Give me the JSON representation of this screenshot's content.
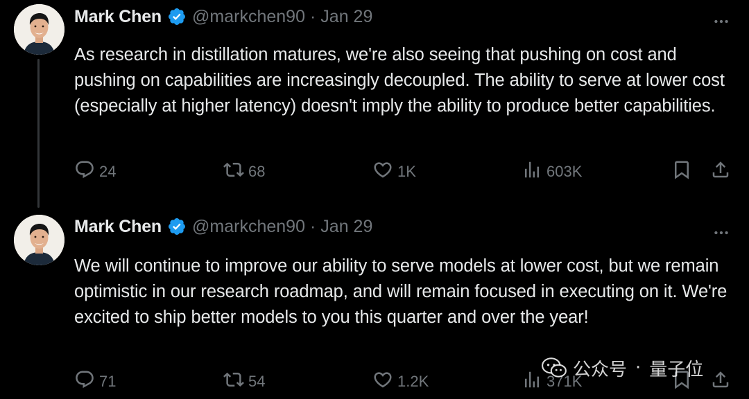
{
  "tweets": [
    {
      "author": "Mark Chen",
      "handle": "@markchen90",
      "separator": "·",
      "date": "Jan 29",
      "text": "As research in distillation matures, we're also seeing that pushing on cost and pushing on capabilities are increasingly decoupled. The ability to serve at lower cost (especially at higher latency) doesn't imply the ability to produce better capabilities.",
      "replies": "24",
      "reposts": "68",
      "likes": "1K",
      "views": "603K"
    },
    {
      "author": "Mark Chen",
      "handle": "@markchen90",
      "separator": "·",
      "date": "Jan 29",
      "text": "We will continue to improve our ability to serve models at lower cost, but we remain optimistic in our research roadmap, and will remain focused in executing on it. We're excited to ship better models to you this quarter and over the year!",
      "replies": "71",
      "reposts": "54",
      "likes": "1.2K",
      "views": "371K"
    }
  ],
  "watermark": {
    "channel": "公众号",
    "dot": "·",
    "name": "量子位"
  },
  "colors": {
    "background": "#000000",
    "text": "#e7e9ea",
    "secondary": "#71767b",
    "verified": "#1d9bf0",
    "thread_line": "#333639"
  },
  "icons": [
    "avatar",
    "verified-badge-icon",
    "more-icon",
    "reply-icon",
    "repost-icon",
    "like-icon",
    "views-icon",
    "bookmark-icon",
    "share-icon",
    "wechat-icon"
  ]
}
